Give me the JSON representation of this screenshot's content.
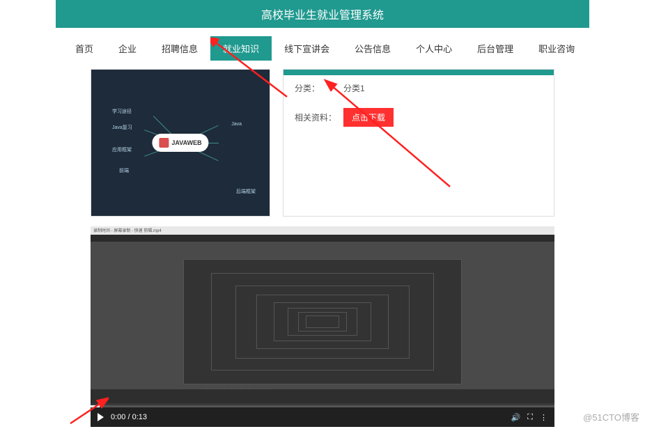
{
  "header": {
    "title": "高校毕业生就业管理系统"
  },
  "nav": {
    "items": [
      {
        "label": "首页"
      },
      {
        "label": "企业"
      },
      {
        "label": "招聘信息"
      },
      {
        "label": "就业知识"
      },
      {
        "label": "线下宣讲会"
      },
      {
        "label": "公告信息"
      },
      {
        "label": "个人中心"
      },
      {
        "label": "后台管理"
      },
      {
        "label": "职业咨询"
      }
    ],
    "active_index": 3
  },
  "mindmap": {
    "center": "JAVAWEB",
    "nodes": [
      "学习途径",
      "Java复习",
      "应用框架",
      "前端",
      "Java",
      "后端框架"
    ]
  },
  "info": {
    "rows": [
      {
        "label": "分类：",
        "value": "分类1"
      },
      {
        "label": "相关资料：",
        "button": "点击下载"
      }
    ]
  },
  "video": {
    "titlebar": "录制时间 - 屏幕录制 - 快速 剪辑.mp4",
    "current_time": "0:00",
    "duration": "0:13"
  },
  "watermark": "@51CTO博客"
}
